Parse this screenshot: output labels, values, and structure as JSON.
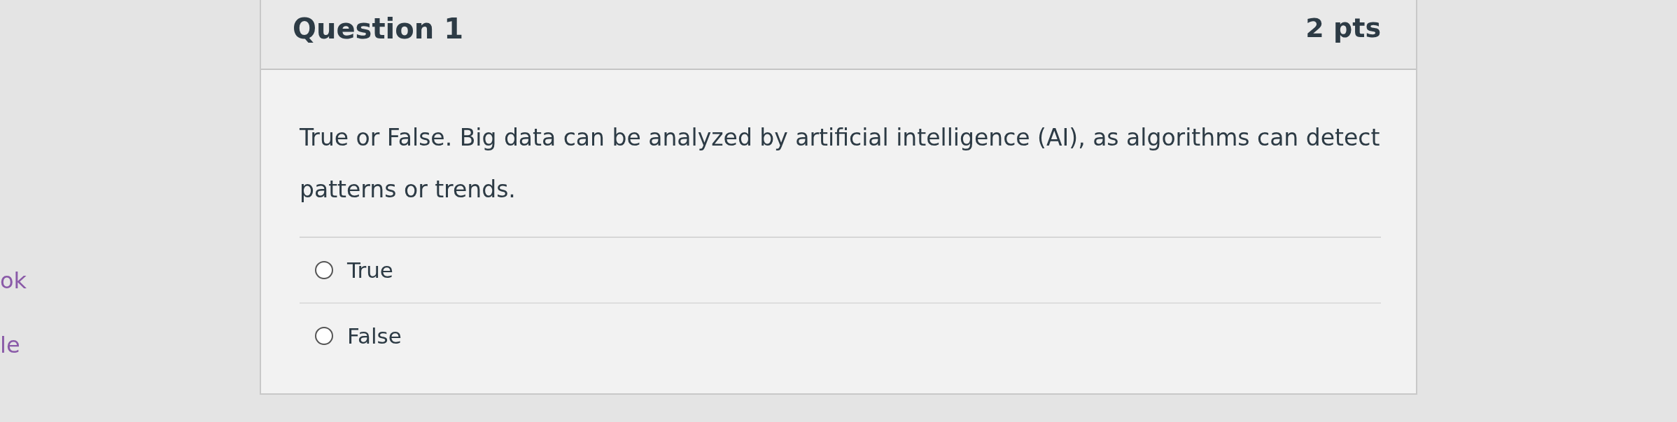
{
  "side_links": [
    "ok",
    "le"
  ],
  "question": {
    "title": "Question 1",
    "points": "2 pts",
    "text": "True or False. Big data can be analyzed by artificial intelligence (AI), as algorithms can detect patterns or trends.",
    "options": [
      {
        "label": "True",
        "selected": false
      },
      {
        "label": "False",
        "selected": false
      }
    ]
  }
}
